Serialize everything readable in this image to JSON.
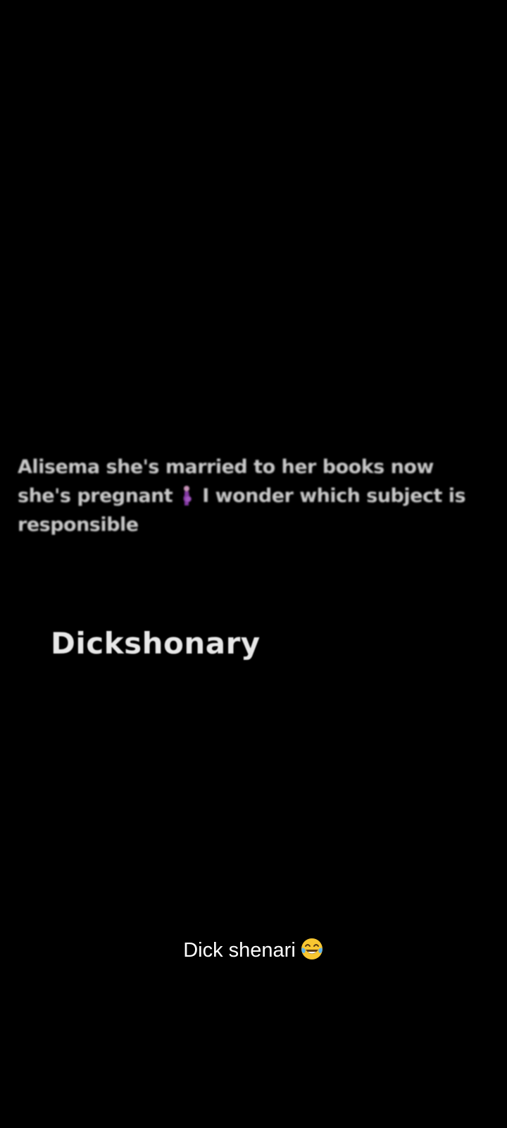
{
  "media": {
    "post_line_1": "Alisema she's married to her books now",
    "post_line_2_start": "she's pregnant",
    "post_line_2_end": "I wonder which subject is",
    "post_line_3": "responsible",
    "post_emoji": "pregnant-woman-icon",
    "reply": "Dickshonary"
  },
  "caption": {
    "text": "Dick shenari",
    "emoji": "tears-of-joy-icon"
  },
  "colors": {
    "background": "#000000",
    "post_text": "#d9d9d9",
    "caption_text": "#ffffff"
  }
}
